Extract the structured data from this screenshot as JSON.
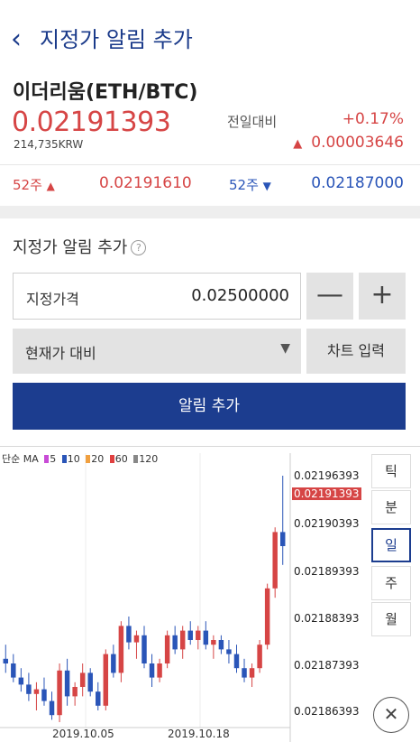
{
  "header": {
    "back_icon": "chevron-left-icon",
    "title": "지정가 알림 추가"
  },
  "coin": {
    "name": "이더리움(ETH/BTC)",
    "price": "0.02191393",
    "krw": "214,735KRW",
    "compare_label": "전일대비",
    "change_pct": "+0.17%",
    "change_abs": "0.00003646",
    "up_color": "#d64545",
    "down_color": "#2a55b8"
  },
  "week52": {
    "high_label": "52주",
    "high_value": "0.02191610",
    "low_label": "52주",
    "low_value": "0.02187000"
  },
  "alert_form": {
    "section_title": "지정가 알림 추가",
    "help_icon": "question-circle-icon",
    "price_label": "지정가격",
    "price_value": "0.02500000",
    "minus_label": "—",
    "plus_label": "+",
    "select_value": "현재가 대비",
    "chart_input_label": "차트 입력",
    "submit_label": "알림 추가",
    "accent": "#1c3d8f"
  },
  "chart": {
    "legend": {
      "type_label": "단순",
      "ma_label": "MA",
      "periods": [
        "5",
        "10",
        "20",
        "60",
        "120"
      ],
      "colors": [
        "#c84bd6",
        "#2a55b8",
        "#f0a040",
        "#e04040",
        "#888888"
      ]
    },
    "y_ticks": [
      "0.02196393",
      "0.02190393",
      "0.02189393",
      "0.02188393",
      "0.02187393",
      "0.02186393"
    ],
    "current_price_label": "0.02191393",
    "x_ticks": [
      "2019.10.05",
      "2019.10.18"
    ],
    "timeframes": [
      "틱",
      "분",
      "일",
      "주",
      "월"
    ],
    "active_timeframe": "일",
    "close_icon": "close-circle-icon"
  },
  "chart_data": {
    "type": "candlestick",
    "ylim": [
      0.02186,
      0.02197
    ],
    "y_tick_values": [
      0.02196393,
      0.02190393,
      0.02189393,
      0.02188393,
      0.02187393,
      0.02186393
    ],
    "current": 0.02191393,
    "candles": [
      [
        0.021882,
        0.021888,
        0.021876,
        0.02188
      ],
      [
        0.02188,
        0.021884,
        0.021872,
        0.021874
      ],
      [
        0.021874,
        0.021878,
        0.021868,
        0.021871
      ],
      [
        0.021871,
        0.021876,
        0.021864,
        0.021867
      ],
      [
        0.021867,
        0.021872,
        0.02186,
        0.021869
      ],
      [
        0.021869,
        0.021874,
        0.021862,
        0.021864
      ],
      [
        0.021864,
        0.021868,
        0.021856,
        0.021858
      ],
      [
        0.021858,
        0.02188,
        0.021855,
        0.021877
      ],
      [
        0.021877,
        0.021882,
        0.021862,
        0.021866
      ],
      [
        0.021866,
        0.021872,
        0.021862,
        0.02187
      ],
      [
        0.02187,
        0.02188,
        0.021866,
        0.021876
      ],
      [
        0.021876,
        0.021878,
        0.021866,
        0.021868
      ],
      [
        0.021868,
        0.021872,
        0.02186,
        0.021862
      ],
      [
        0.021862,
        0.021886,
        0.02186,
        0.021884
      ],
      [
        0.021884,
        0.021888,
        0.021874,
        0.021876
      ],
      [
        0.021876,
        0.021898,
        0.021872,
        0.021896
      ],
      [
        0.021896,
        0.0219,
        0.021886,
        0.021889
      ],
      [
        0.021889,
        0.021894,
        0.021882,
        0.021892
      ],
      [
        0.021892,
        0.021896,
        0.021878,
        0.02188
      ],
      [
        0.02188,
        0.021884,
        0.02187,
        0.021874
      ],
      [
        0.021874,
        0.021882,
        0.021872,
        0.02188
      ],
      [
        0.02188,
        0.021894,
        0.021878,
        0.021892
      ],
      [
        0.021892,
        0.021896,
        0.021884,
        0.021886
      ],
      [
        0.021886,
        0.021896,
        0.021882,
        0.021894
      ],
      [
        0.021894,
        0.021898,
        0.021888,
        0.02189
      ],
      [
        0.02189,
        0.021896,
        0.021886,
        0.021894
      ],
      [
        0.021894,
        0.021898,
        0.021886,
        0.021888
      ],
      [
        0.021888,
        0.021892,
        0.021882,
        0.02189
      ],
      [
        0.02189,
        0.021892,
        0.021884,
        0.021886
      ],
      [
        0.021886,
        0.02189,
        0.02188,
        0.021884
      ],
      [
        0.021884,
        0.021888,
        0.021876,
        0.021878
      ],
      [
        0.021878,
        0.021882,
        0.021872,
        0.021874
      ],
      [
        0.021874,
        0.02188,
        0.02187,
        0.021878
      ],
      [
        0.021878,
        0.02189,
        0.021876,
        0.021888
      ],
      [
        0.021888,
        0.021914,
        0.021886,
        0.021912
      ],
      [
        0.021912,
        0.021938,
        0.021908,
        0.021936
      ],
      [
        0.021936,
        0.02196,
        0.021922,
        0.02193
      ]
    ]
  }
}
